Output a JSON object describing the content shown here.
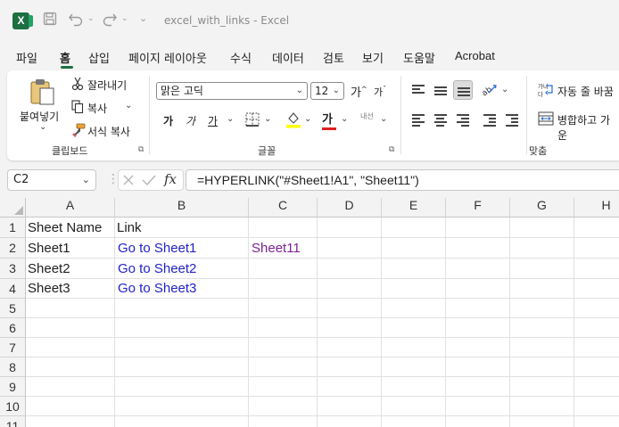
{
  "window": {
    "title": "excel_with_links  -  Excel"
  },
  "tabs": [
    "파일",
    "홈",
    "삽입",
    "페이지 레이아웃",
    "수식",
    "데이터",
    "검토",
    "보기",
    "도움말",
    "Acrobat"
  ],
  "ribbon": {
    "clipboard": {
      "paste_label": "붙여넣기",
      "cut_label": "잘라내기",
      "copy_label": "복사",
      "format_painter_label": "서식 복사",
      "group_label": "클립보드"
    },
    "font": {
      "font_name": "맑은 고딕",
      "font_size": "12",
      "bold": "가",
      "italic": "가",
      "underline": "가",
      "font_color_glyph": "가",
      "phonetic": "내선",
      "group_label": "글꼴",
      "grow": "가",
      "shrink": "가"
    },
    "alignment": {
      "wrap_label": "자동 줄 바꿈",
      "merge_label": "병합하고 가운",
      "group_label": "맞춤"
    }
  },
  "formula_bar": {
    "name_box": "C2",
    "fx": "fx",
    "formula": "=HYPERLINK(\"#Sheet1!A1\", \"Sheet11\")"
  },
  "columns": [
    "A",
    "B",
    "C",
    "D",
    "E",
    "F",
    "G",
    "H"
  ],
  "rows": [
    "1",
    "2",
    "3",
    "4",
    "5",
    "6",
    "7",
    "8",
    "9",
    "10",
    "11"
  ],
  "cells": {
    "A1": "Sheet Name",
    "B1": "Link",
    "A2": "Sheet1",
    "B2": "Go to Sheet1",
    "C2": "Sheet11",
    "A3": "Sheet2",
    "B3": "Go to Sheet2",
    "A4": "Sheet3",
    "B4": "Go to Sheet3"
  },
  "colors": {
    "link": "#2323c7",
    "visited_link": "#7a2390",
    "excel_green": "#1d6f42"
  }
}
